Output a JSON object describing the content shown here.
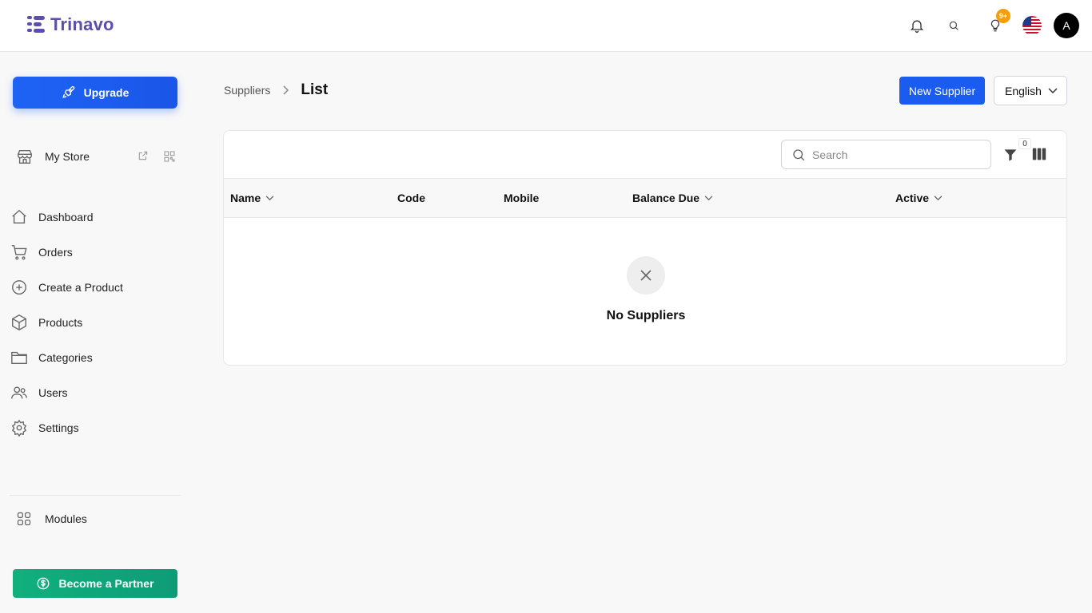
{
  "app": {
    "brand": "Trinavo",
    "notification_badge": "9+",
    "avatar_initial": "A"
  },
  "sidebar": {
    "upgrade_label": "Upgrade",
    "store_label": "My Store",
    "nav": [
      {
        "label": "Dashboard",
        "icon": "home-icon"
      },
      {
        "label": "Orders",
        "icon": "cart-icon"
      },
      {
        "label": "Create a Product",
        "icon": "plus-circle-icon"
      },
      {
        "label": "Products",
        "icon": "box-icon"
      },
      {
        "label": "Categories",
        "icon": "folder-icon"
      },
      {
        "label": "Users",
        "icon": "users-icon"
      },
      {
        "label": "Settings",
        "icon": "gear-icon"
      }
    ],
    "modules_label": "Modules",
    "partner_label": "Become a Partner"
  },
  "header": {
    "breadcrumb_parent": "Suppliers",
    "breadcrumb_current": "List",
    "new_button": "New Supplier",
    "language": "English"
  },
  "table": {
    "search_placeholder": "Search",
    "filter_count": "0",
    "columns": [
      "Name",
      "Code",
      "Mobile",
      "Balance Due",
      "Active"
    ],
    "empty_text": "No Suppliers"
  },
  "colors": {
    "primary": "#1a5cf0",
    "brand": "#5b4fa8",
    "partner": "#10b07c",
    "badge": "#f59e0b"
  }
}
